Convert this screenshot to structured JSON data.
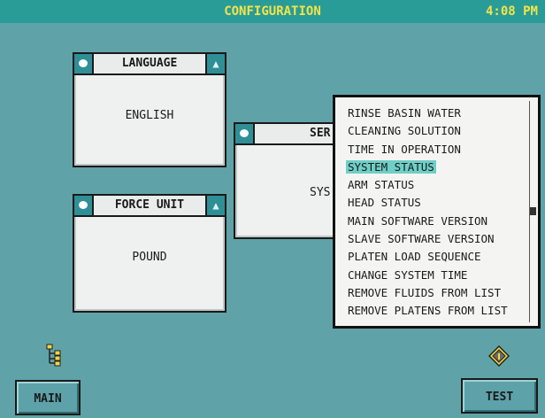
{
  "header": {
    "title": "CONFIGURATION",
    "time": "4:08 PM"
  },
  "panels": {
    "language": {
      "title": "LANGUAGE",
      "value": "ENGLISH"
    },
    "force_unit": {
      "title": "FORCE UNIT",
      "value": "POUND"
    },
    "service": {
      "title": "SER",
      "value": "SYS"
    }
  },
  "menu": {
    "items": [
      "RINSE BASIN WATER",
      "CLEANING SOLUTION",
      "TIME IN OPERATION",
      "SYSTEM STATUS",
      "ARM STATUS",
      "HEAD STATUS",
      "MAIN SOFTWARE VERSION",
      "SLAVE SOFTWARE VERSION",
      "PLATEN LOAD SEQUENCE",
      "CHANGE SYSTEM TIME",
      "REMOVE FLUIDS FROM LIST",
      "REMOVE PLATENS FROM LIST"
    ],
    "selected_index": 3
  },
  "buttons": {
    "main": "MAIN",
    "test": "TEST"
  },
  "icons": {
    "tree": "tree-icon",
    "info": "info-icon"
  },
  "colors": {
    "background": "#5fa3a8",
    "titlebar": "#2a9c97",
    "title_text": "#f3e34a",
    "selection": "#6fcfc7"
  }
}
